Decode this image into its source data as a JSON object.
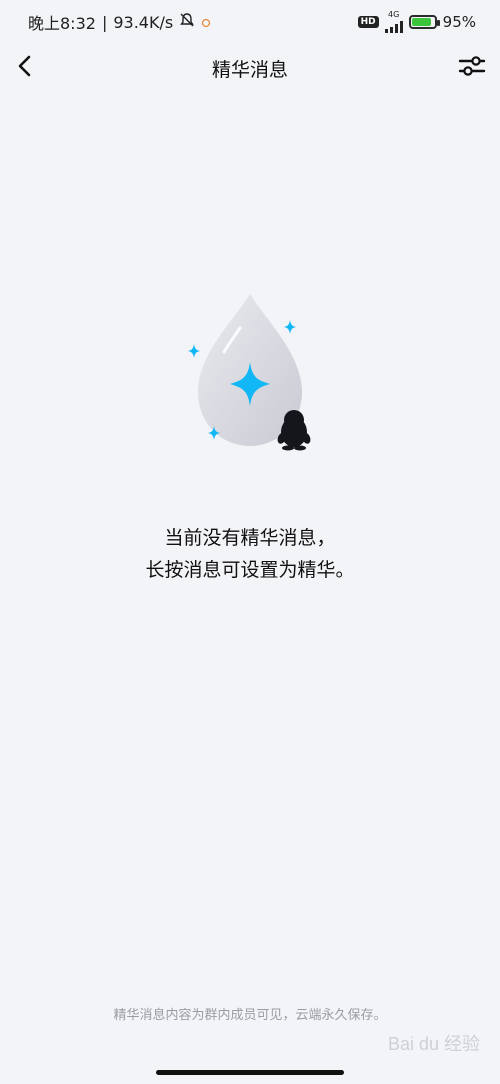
{
  "status_bar": {
    "time": "晚上8:32",
    "separator": "|",
    "speed": "93.4K/s",
    "hd_badge": "HD",
    "network_type": "4G",
    "battery_percent": "95%",
    "battery_level": 0.95
  },
  "nav": {
    "title": "精华消息"
  },
  "empty_state": {
    "line1": "当前没有精华消息，",
    "line2": "长按消息可设置为精华。"
  },
  "footer": {
    "note": "精华消息内容为群内成员可见，云端永久保存。"
  },
  "watermark": {
    "text": "Bai du 经验"
  },
  "colors": {
    "background": "#f3f4f8",
    "accent": "#12b7f5",
    "battery": "#3cc43c"
  }
}
